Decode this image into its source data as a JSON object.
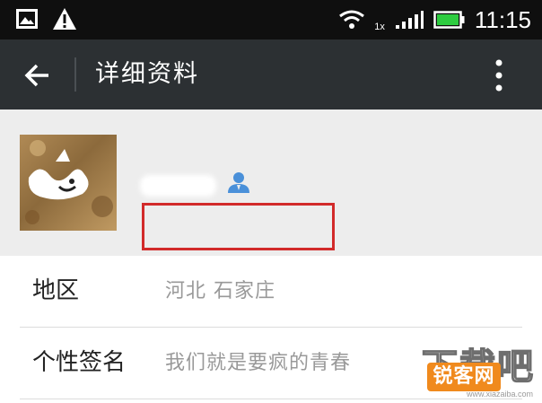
{
  "status_bar": {
    "network": "1x",
    "time": "11:15",
    "icons": [
      "image-icon",
      "warning-icon",
      "wifi-icon",
      "signal-icon",
      "battery-icon"
    ]
  },
  "action_bar": {
    "title": "详细资料",
    "icons": [
      "back-arrow-icon",
      "more-vertical-icon"
    ]
  },
  "profile": {
    "icons": [
      "person-icon"
    ],
    "highlight_color": "#d22a2a"
  },
  "info": {
    "rows": [
      {
        "label": "地区",
        "value": "河北  石家庄"
      },
      {
        "label": "个性签名",
        "value": "我们就是要疯的青春"
      }
    ]
  },
  "watermark": {
    "big_text": "下载吧",
    "logo_text": "锐客网",
    "url": "www.xiazaiba.com"
  },
  "colors": {
    "status_bar": "#0f0f0f",
    "action_bar": "#2c3033",
    "background": "#ededed",
    "battery": "#2ecc40",
    "accent_icon": "#4a90d9"
  }
}
